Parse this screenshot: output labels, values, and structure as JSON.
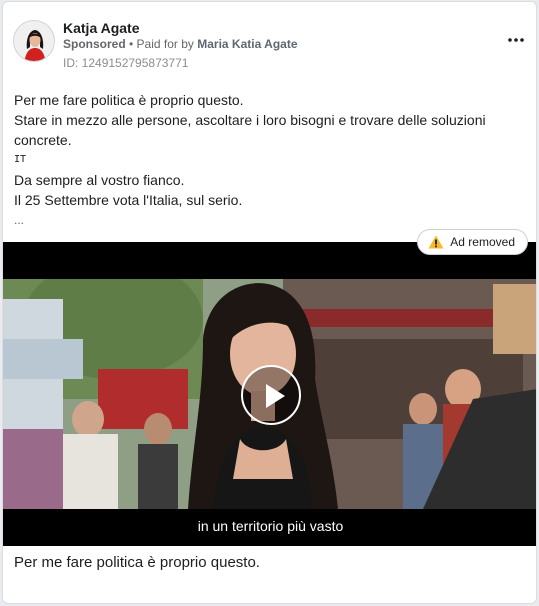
{
  "post": {
    "author_name": "Katja Agate",
    "sponsored_label": "Sponsored",
    "separator": " • ",
    "paid_for_prefix": "Paid for by ",
    "paid_for_name": "Maria Katia Agate",
    "ad_id": "ID: 1249152795873771",
    "more_icon": "more-horizontal-icon",
    "body_lines": [
      "Per me fare politica è proprio questo.",
      "Stare in mezzo alle persone, ascoltare i loro bisogni e trovare delle soluzioni",
      "concrete.",
      "IT",
      "Da sempre al vostro fianco.",
      "Il 25 Settembre vota l'Italia, sul serio."
    ],
    "ellipsis": "...",
    "ad_removed_label": "Ad removed",
    "video_caption": "in un territorio più vasto",
    "footer_text": "Per me fare politica è proprio questo."
  },
  "colors": {
    "warning_icon": "#f7b928",
    "secondary_text": "#65676b"
  }
}
